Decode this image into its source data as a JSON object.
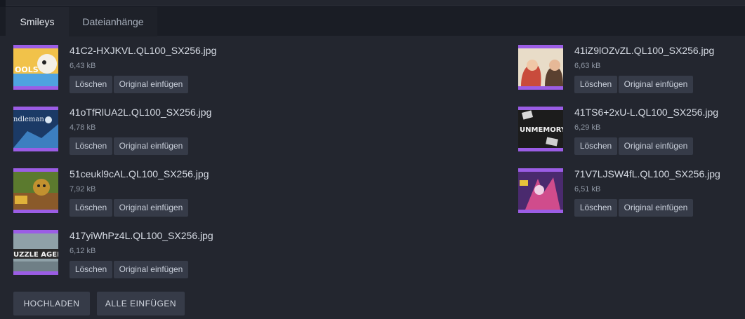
{
  "tabs": [
    {
      "label": "Smileys",
      "active": true
    },
    {
      "label": "Dateianhänge",
      "active": false
    }
  ],
  "attachments": [
    {
      "name": "41C2-HXJKVL.QL100_SX256.jpg",
      "size": "6,43 kB",
      "thumb_overlay": "OOLS",
      "thumb_colors": [
        "#e8b23a",
        "#4fa3e0"
      ]
    },
    {
      "name": "41iZ9lOZvZL.QL100_SX256.jpg",
      "size": "6,63 kB",
      "thumb_overlay": "",
      "thumb_colors": [
        "#c94b3c",
        "#e8dcc8"
      ]
    },
    {
      "name": "41oTfRlUA2L.QL100_SX256.jpg",
      "size": "4,78 kB",
      "thumb_overlay": "ndleman",
      "thumb_colors": [
        "#1b3a66",
        "#3c7fc0"
      ]
    },
    {
      "name": "41TS6+2xU-L.QL100_SX256.jpg",
      "size": "6,29 kB",
      "thumb_overlay": "UNMEMORY",
      "thumb_colors": [
        "#1c1c1c",
        "#d9d9d9"
      ]
    },
    {
      "name": "51ceukl9cAL.QL100_SX256.jpg",
      "size": "7,92 kB",
      "thumb_overlay": "",
      "thumb_colors": [
        "#5b7a2e",
        "#c2912f"
      ]
    },
    {
      "name": "71V7LJSW4fL.QL100_SX256.jpg",
      "size": "6,51 kB",
      "thumb_overlay": "",
      "thumb_colors": [
        "#4a2a6e",
        "#d04c8c"
      ]
    },
    {
      "name": "417yiWhPz4L.QL100_SX256.jpg",
      "size": "6,12 kB",
      "thumb_overlay": "UZZLE AGEN",
      "thumb_colors": [
        "#8fa1a8",
        "#2b2b2b"
      ]
    }
  ],
  "buttons": {
    "delete": "Löschen",
    "insert_original": "Original einfügen"
  },
  "footer": {
    "upload": "HOCHLADEN",
    "insert_all": "ALLE EINFÜGEN"
  },
  "colors": {
    "accent": "#9b5de5",
    "panel": "#23262f",
    "button": "#363b48"
  }
}
